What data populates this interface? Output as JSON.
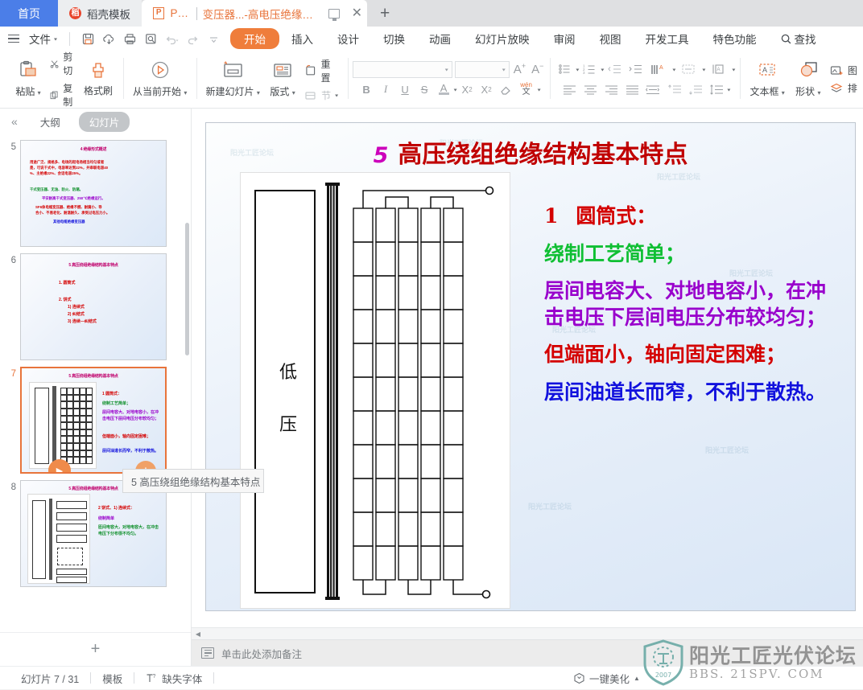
{
  "tabbar": {
    "home_label": "首页",
    "template_label": "稻壳模板",
    "template_icon": "dao-logo-icon",
    "doc_tab": {
      "type_label": "PPT",
      "title": "变压器...-高电压绝缘技术",
      "icon": "ppt-file-icon",
      "monitor_icon": "present-monitor-icon",
      "close_icon": "close-icon"
    },
    "new_tab_label": "+"
  },
  "menubar": {
    "menu_icon": "hamburger-icon",
    "file_label": "文件",
    "quick_icons": [
      "save-icon",
      "cloud-sync-icon",
      "print-icon",
      "print-preview-icon",
      "undo-icon",
      "redo-icon",
      "customize-icon"
    ],
    "tabs": [
      {
        "label": "开始",
        "selected": true
      },
      {
        "label": "插入",
        "selected": false
      },
      {
        "label": "设计",
        "selected": false
      },
      {
        "label": "切换",
        "selected": false
      },
      {
        "label": "动画",
        "selected": false
      },
      {
        "label": "幻灯片放映",
        "selected": false
      },
      {
        "label": "审阅",
        "selected": false
      },
      {
        "label": "视图",
        "selected": false
      },
      {
        "label": "开发工具",
        "selected": false
      },
      {
        "label": "特色功能",
        "selected": false
      }
    ],
    "find_label": "查找",
    "find_icon": "search-icon",
    "accent_color": "#ef7d3b"
  },
  "ribbon": {
    "clipboard": {
      "paste_label": "粘贴",
      "cut_label": "剪切",
      "copy_label": "复制",
      "format_painter_label": "格式刷"
    },
    "slideshow": {
      "from_current_label": "从当前开始"
    },
    "slides": {
      "new_slide_label": "新建幻灯片",
      "layout_label": "版式",
      "reset_label": "重置",
      "section_label": "节"
    },
    "font": {
      "font_name_value": "",
      "font_size_value": "",
      "grow_font_label": "A",
      "shrink_font_label": "A",
      "bold_label": "B",
      "italic_label": "I",
      "underline_label": "U",
      "strike_label": "S",
      "font_color_label": "A",
      "superscript_label": "X",
      "subscript_label": "X",
      "clear_format_icon": "eraser-icon",
      "pinyin_label": "wén"
    },
    "paragraph": {
      "bullets_icon": "bullet-list-icon",
      "numbering_icon": "numbered-list-icon",
      "decrease_indent_icon": "decrease-indent-icon",
      "increase_indent_icon": "increase-indent-icon",
      "text_direction_icon": "text-direction-icon",
      "align_text_icon": "align-text-icon",
      "columns_icon": "columns-icon",
      "align_left_icon": "align-left-icon",
      "align_center_icon": "align-center-icon",
      "align_right_icon": "align-right-icon",
      "justify_icon": "justify-icon",
      "distribute_icon": "distribute-icon",
      "line_spacing_icon": "line-spacing-icon",
      "space_before_icon": "space-before-icon",
      "space_after_icon": "space-after-icon"
    },
    "insert": {
      "textbox_label": "文本框",
      "shape_label": "形状",
      "picture_label": "图",
      "arrange_label": "排"
    }
  },
  "sidebar": {
    "collapse_icon": "collapse-left-icon",
    "outline_tab": "大纲",
    "slides_tab": "幻灯片",
    "add_slide_label": "+",
    "tooltip_text": "5 高压绕组绝缘结构基本特点",
    "thumbnails": [
      {
        "number": "5",
        "title": "4 绝缘形式概述",
        "selected": false,
        "lines": [
          "用途广泛、规格多、电场的起电场相当均匀或者",
          "是，可说干式中，电容率达到22%，并串联电容40",
          "%、主绝缘22%、会话电容25%。",
          "干式变压器、无油、防火、防潮。",
          "平安耐高干式变压器、250℃绝缘运行。",
          "SF6体电缆变压器、绝缘不燃、耐腐小、导",
          "合小、不易老化、耐温耐久、承受过电压力小。",
          "其他电缆绝缘变压器"
        ]
      },
      {
        "number": "6",
        "title": "5 高压绕组绝缘结构基本特点",
        "selected": false,
        "lines": [
          "1. 圆筒式",
          "2. 饼式",
          "1) 连续式",
          "2) 纠结式",
          "3) 连续—纠结式"
        ]
      },
      {
        "number": "7",
        "title": "5 高压绕组绝缘结构基本特点",
        "selected": true,
        "lines": [
          "1 圆筒式：",
          "绕制工艺简单；",
          "层间电容大、对地电容小，在冲击电压下层间电压分布较均匀；",
          "但端面小，轴向固定困难；",
          "层间油道长而窄，不利于散热。"
        ]
      },
      {
        "number": "8",
        "title": "5 高压绕组绝缘结构基本特点",
        "selected": false,
        "lines": [
          "2 饼式、1) 连续式：",
          "绕制简单",
          "匝间电容大，对地电容大，在冲击电压下分布很不均匀。"
        ]
      }
    ]
  },
  "slide": {
    "title_number": "5",
    "title_text": "高压绕组绝缘结构基本特点",
    "figure": {
      "name": "cylindrical-winding-cross-section-diagram",
      "lv_label_chars": [
        "低",
        "压"
      ],
      "winding_columns": 5,
      "winding_rows": 11
    },
    "text_blocks": [
      {
        "index": "1",
        "text": "圆筒式：",
        "color": "#d40000"
      },
      {
        "index": "",
        "text": "绕制工艺简单；",
        "color": "#0fbf33"
      },
      {
        "index": "",
        "text": "层间电容大、对地电容小，在冲击电压下层间电压分布较均匀；",
        "color": "#9900cc"
      },
      {
        "index": "",
        "text": "但端面小，轴向固定困难；",
        "color": "#d40000"
      },
      {
        "index": "",
        "text": "层间油道长而窄，不利于散热。",
        "color": "#1111dd"
      }
    ],
    "watermark_text": "阳光工匠论坛"
  },
  "notes": {
    "placeholder": "单击此处添加备注",
    "icon": "notes-icon"
  },
  "statusbar": {
    "slide_counter": "幻灯片 7 / 31",
    "template_label": "模板",
    "missing_font_label": "缺失字体",
    "missing_font_icon": "font-warning-icon",
    "beautify_label": "一键美化",
    "beautify_icon": "beautify-icon",
    "beautify_caret": "▲"
  },
  "watermark_logo": {
    "cn_text": "阳光工匠光伏论坛",
    "en_text": "BBS. 21SPV. COM",
    "year": "2007",
    "color": "#6aa9a5"
  }
}
